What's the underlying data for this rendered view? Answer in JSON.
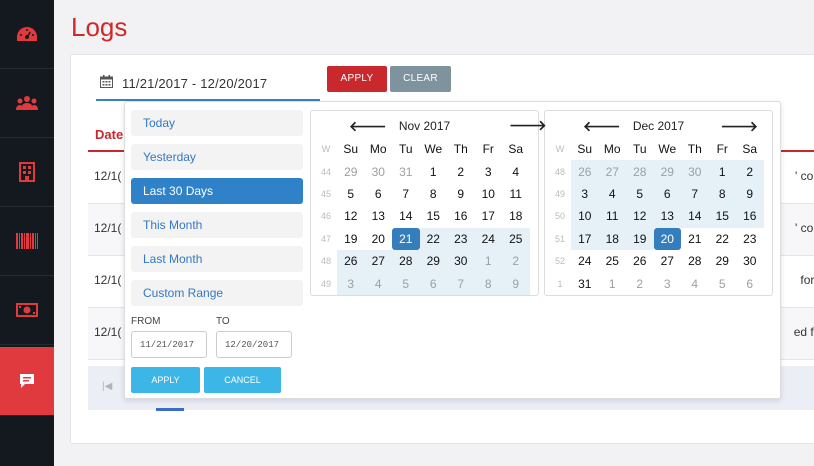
{
  "page": {
    "title": "Logs"
  },
  "sidebar": {
    "items": [
      {
        "icon": "dashboard-icon",
        "active": false
      },
      {
        "icon": "users-icon",
        "active": false
      },
      {
        "icon": "building-icon",
        "active": false
      },
      {
        "icon": "barcode-icon",
        "active": false
      },
      {
        "icon": "money-icon",
        "active": false
      },
      {
        "icon": "logs-icon",
        "active": true
      }
    ]
  },
  "filter": {
    "date_range_value": "11/21/2017 - 12/20/2017",
    "apply_label": "APPLY",
    "clear_label": "CLEAR"
  },
  "table": {
    "header_date": "Date",
    "rows": [
      {
        "date": "12/1(",
        "message": "' comp"
      },
      {
        "date": "12/1(",
        "message": "' comp"
      },
      {
        "date": "12/1(",
        "message": "for 'Fl"
      },
      {
        "date": "12/1(",
        "message": "ed for '"
      }
    ],
    "pager_first": "|◀"
  },
  "picker": {
    "ranges": [
      {
        "label": "Today",
        "active": false
      },
      {
        "label": "Yesterday",
        "active": false
      },
      {
        "label": "Last 30 Days",
        "active": true
      },
      {
        "label": "This Month",
        "active": false
      },
      {
        "label": "Last Month",
        "active": false
      },
      {
        "label": "Custom Range",
        "active": false
      }
    ],
    "from_label": "FROM",
    "to_label": "TO",
    "from_value": "11/21/2017",
    "to_value": "12/20/2017",
    "apply_label": "APPLY",
    "cancel_label": "CANCEL",
    "weekday_headers": [
      "W",
      "Su",
      "Mo",
      "Tu",
      "We",
      "Th",
      "Fr",
      "Sa"
    ],
    "calendars": [
      {
        "title": "Nov 2017",
        "prev": "🡐",
        "next": "🡒",
        "weeks": [
          {
            "wk": "44",
            "days": [
              [
                "29",
                "off"
              ],
              [
                "30",
                "off"
              ],
              [
                "31",
                "off"
              ],
              [
                "1",
                ""
              ],
              [
                "2",
                ""
              ],
              [
                "3",
                ""
              ],
              [
                "4",
                ""
              ]
            ]
          },
          {
            "wk": "45",
            "days": [
              [
                "5",
                ""
              ],
              [
                "6",
                ""
              ],
              [
                "7",
                ""
              ],
              [
                "8",
                ""
              ],
              [
                "9",
                ""
              ],
              [
                "10",
                ""
              ],
              [
                "11",
                ""
              ]
            ]
          },
          {
            "wk": "46",
            "days": [
              [
                "12",
                ""
              ],
              [
                "13",
                ""
              ],
              [
                "14",
                ""
              ],
              [
                "15",
                ""
              ],
              [
                "16",
                ""
              ],
              [
                "17",
                ""
              ],
              [
                "18",
                ""
              ]
            ]
          },
          {
            "wk": "47",
            "days": [
              [
                "19",
                ""
              ],
              [
                "20",
                ""
              ],
              [
                "21",
                "sel"
              ],
              [
                "22",
                "inrange"
              ],
              [
                "23",
                "inrange"
              ],
              [
                "24",
                "inrange"
              ],
              [
                "25",
                "inrange"
              ]
            ]
          },
          {
            "wk": "48",
            "days": [
              [
                "26",
                "inrange"
              ],
              [
                "27",
                "inrange"
              ],
              [
                "28",
                "inrange"
              ],
              [
                "29",
                "inrange"
              ],
              [
                "30",
                "inrange"
              ],
              [
                "1",
                "off inrange"
              ],
              [
                "2",
                "off inrange"
              ]
            ]
          },
          {
            "wk": "49",
            "days": [
              [
                "3",
                "off inrange"
              ],
              [
                "4",
                "off inrange"
              ],
              [
                "5",
                "off inrange"
              ],
              [
                "6",
                "off inrange"
              ],
              [
                "7",
                "off inrange"
              ],
              [
                "8",
                "off inrange"
              ],
              [
                "9",
                "off inrange"
              ]
            ]
          }
        ]
      },
      {
        "title": "Dec 2017",
        "prev": "🡐",
        "next": "🡒",
        "weeks": [
          {
            "wk": "48",
            "days": [
              [
                "26",
                "off inrange"
              ],
              [
                "27",
                "off inrange"
              ],
              [
                "28",
                "off inrange"
              ],
              [
                "29",
                "off inrange"
              ],
              [
                "30",
                "off inrange"
              ],
              [
                "1",
                "inrange"
              ],
              [
                "2",
                "inrange"
              ]
            ]
          },
          {
            "wk": "49",
            "days": [
              [
                "3",
                "inrange"
              ],
              [
                "4",
                "inrange"
              ],
              [
                "5",
                "inrange"
              ],
              [
                "6",
                "inrange"
              ],
              [
                "7",
                "inrange"
              ],
              [
                "8",
                "inrange"
              ],
              [
                "9",
                "inrange"
              ]
            ]
          },
          {
            "wk": "50",
            "days": [
              [
                "10",
                "inrange"
              ],
              [
                "11",
                "inrange"
              ],
              [
                "12",
                "inrange"
              ],
              [
                "13",
                "inrange"
              ],
              [
                "14",
                "inrange"
              ],
              [
                "15",
                "inrange"
              ],
              [
                "16",
                "inrange"
              ]
            ]
          },
          {
            "wk": "51",
            "days": [
              [
                "17",
                "inrange"
              ],
              [
                "18",
                "inrange"
              ],
              [
                "19",
                "inrange"
              ],
              [
                "20",
                "sel"
              ],
              [
                "21",
                ""
              ],
              [
                "22",
                ""
              ],
              [
                "23",
                ""
              ]
            ]
          },
          {
            "wk": "52",
            "days": [
              [
                "24",
                ""
              ],
              [
                "25",
                ""
              ],
              [
                "26",
                ""
              ],
              [
                "27",
                ""
              ],
              [
                "28",
                ""
              ],
              [
                "29",
                ""
              ],
              [
                "30",
                ""
              ]
            ]
          },
          {
            "wk": "1",
            "days": [
              [
                "31",
                ""
              ],
              [
                "1",
                "off"
              ],
              [
                "2",
                "off"
              ],
              [
                "3",
                "off"
              ],
              [
                "4",
                "off"
              ],
              [
                "5",
                "off"
              ],
              [
                "6",
                "off"
              ]
            ]
          }
        ]
      }
    ]
  },
  "colors": {
    "brand_red": "#c9282c",
    "sidebar_bg": "#14191f",
    "active_blue": "#357ebd",
    "range_bg": "#e6f0f7"
  }
}
